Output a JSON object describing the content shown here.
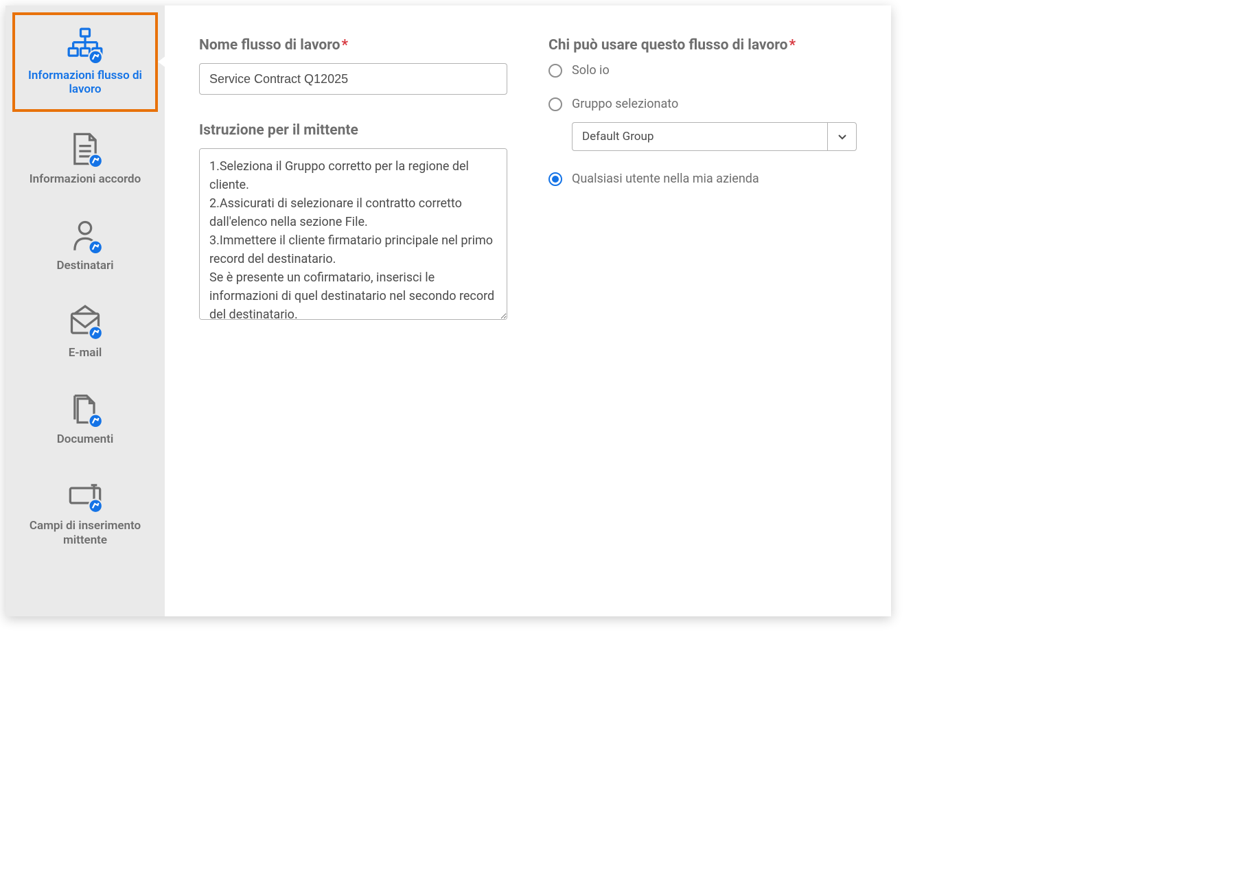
{
  "sidebar": {
    "items": [
      {
        "label": "Informazioni flusso di lavoro",
        "active": true
      },
      {
        "label": "Informazioni accordo",
        "active": false
      },
      {
        "label": "Destinatari",
        "active": false
      },
      {
        "label": "E-mail",
        "active": false
      },
      {
        "label": "Documenti",
        "active": false
      },
      {
        "label": "Campi di inserimento mittente",
        "active": false
      }
    ]
  },
  "form": {
    "workflow_name": {
      "label": "Nome flusso di lavoro",
      "value": "Service Contract Q12025"
    },
    "instructions": {
      "label": "Istruzione per il mittente",
      "value": "1.Seleziona il Gruppo corretto per la regione del cliente.\n2.Assicurati di selezionare il contratto corretto dall'elenco nella sezione File.\n3.Immettere il cliente firmatario principale nel primo record del destinatario.\nSe è presente un cofirmatario, inserisci le informazioni di quel destinatario nel secondo record del destinatario."
    },
    "who_can_use": {
      "label": "Chi può usare questo flusso di lavoro",
      "options": {
        "only_me": "Solo io",
        "selected_group": "Gruppo selezionato",
        "any_user": "Qualsiasi utente nella mia azienda"
      },
      "group_dropdown": {
        "value": "Default Group"
      },
      "selected": "any_user"
    }
  }
}
